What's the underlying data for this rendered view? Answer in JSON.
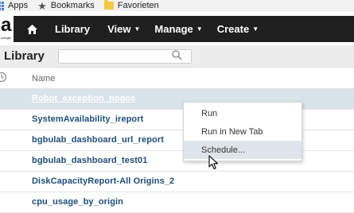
{
  "bookmarks": [
    {
      "label": "Apps",
      "icon": "apps-icon"
    },
    {
      "label": "Bookmarks",
      "icon": "star-icon"
    },
    {
      "label": "Favorieten",
      "icon": "folder-icon"
    }
  ],
  "logo": {
    "letter": "a",
    "tagline": "nologie"
  },
  "nav": {
    "library": "Library",
    "view": "View",
    "manage": "Manage",
    "create": "Create"
  },
  "library": {
    "title": "Library",
    "search_value": ""
  },
  "table": {
    "columns": {
      "name": "Name"
    },
    "rows": [
      "Robot_exception_nogos",
      "SystemAvailability_ireport",
      "bgbulab_dashboard_url_report",
      "bgbulab_dashboard_test01",
      "DiskCapacityReport-All Origins_2",
      "cpu_usage_by_origin"
    ]
  },
  "context_menu": {
    "items": [
      "Run",
      "Run in New Tab",
      "Schedule..."
    ],
    "hover_index": 2
  },
  "colors": {
    "navbar": "#1f1f1f",
    "link": "#1f4e79",
    "selected_row": "#d9e3ea",
    "menu_hover": "#dde5ea"
  }
}
